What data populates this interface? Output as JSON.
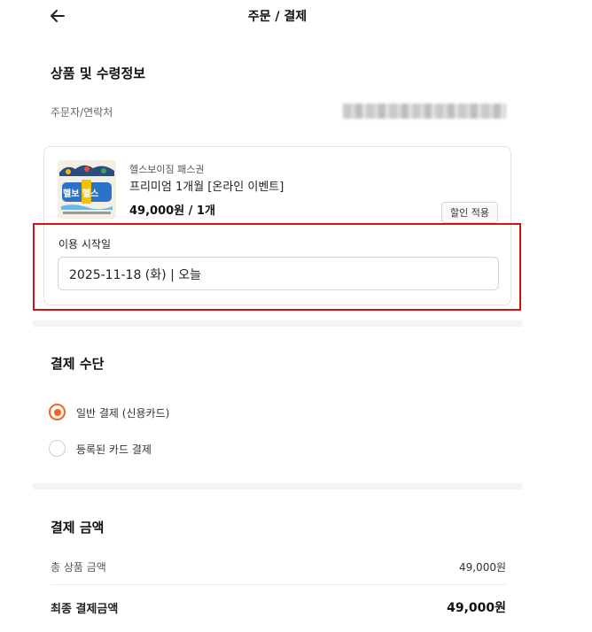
{
  "header": {
    "title": "주문 / 결제"
  },
  "order_info": {
    "section_title": "상품 및 수령정보",
    "contact_label": "주문자/연락처",
    "contact_value": "••••• •••• •••• •••"
  },
  "product": {
    "brand": "헬스보이짐  패스권",
    "name": "프리미엄 1개월 [온라인 이벤트]",
    "price": "49,000원 / 1개",
    "discount_label": "할인 적용",
    "thumb_logo": "헬보  헬스",
    "start_date_label": "이용 시작일",
    "start_date_value": "2025-11-18 (화) | 오늘"
  },
  "payment_method": {
    "section_title": "결제 수단",
    "options": [
      {
        "label": "일반 결제 (신용카드)",
        "selected": true
      },
      {
        "label": "등록된 카드 결제",
        "selected": false
      }
    ]
  },
  "payment_amount": {
    "section_title": "결제 금액",
    "total_label": "총 상품 금액",
    "total_value": "49,000원",
    "final_label": "최종 결제금액",
    "final_value": "49,000원"
  },
  "colors": {
    "accent": "#f2651c",
    "highlight": "#d01212",
    "band": "#f3f3f3"
  }
}
